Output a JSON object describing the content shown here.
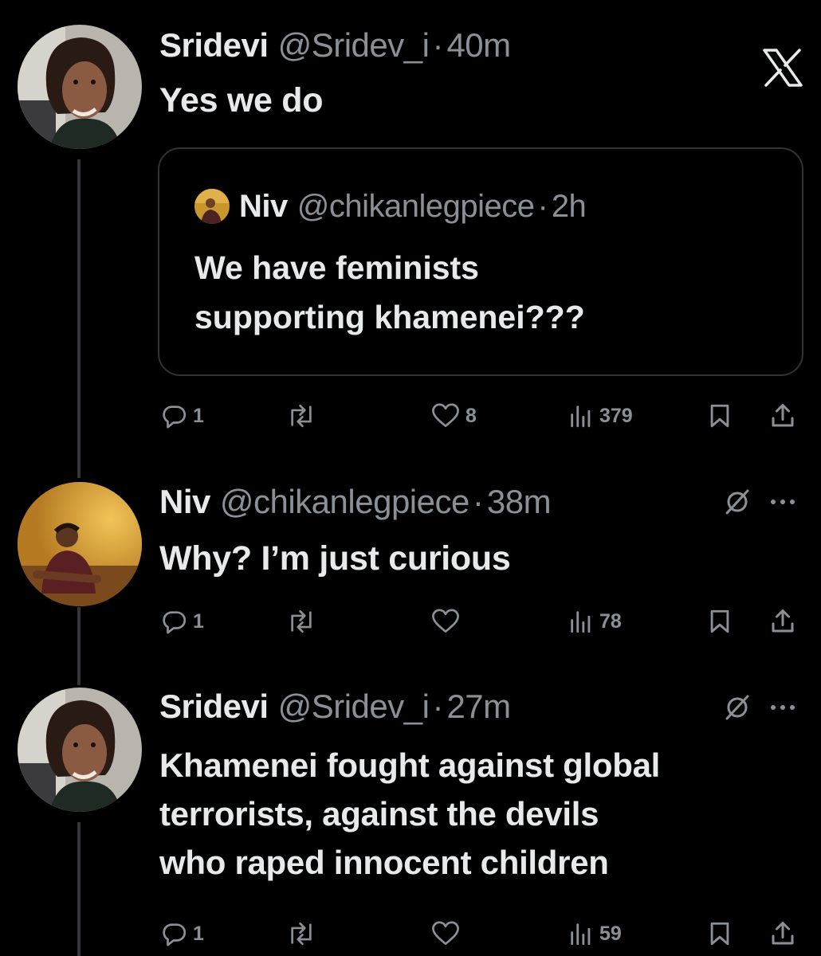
{
  "logo": "x-logo",
  "tweets": [
    {
      "name": "Sridevi",
      "handle": "@Sridev_i",
      "separator": "·",
      "time": "40m",
      "text": "Yes we do",
      "quote": {
        "name": "Niv",
        "handle": "@chikanlegpiece",
        "separator": "·",
        "time": "2h",
        "text_lines": [
          "We have feminists",
          "supporting khamenei???"
        ]
      },
      "actions": {
        "replies": "1",
        "reposts": "",
        "likes": "8",
        "views": "379"
      }
    },
    {
      "name": "Niv",
      "handle": "@chikanlegpiece",
      "separator": "·",
      "time": "38m",
      "text": "Why? I’m just curious",
      "actions": {
        "replies": "1",
        "reposts": "",
        "likes": "",
        "views": "78"
      }
    },
    {
      "name": "Sridevi",
      "handle": "@Sridev_i",
      "separator": "·",
      "time": "27m",
      "text_lines": [
        "Khamenei fought against global",
        "terrorists, against the devils",
        "who raped innocent children"
      ],
      "actions": {
        "replies": "1",
        "reposts": "",
        "likes": "",
        "views": "59"
      }
    }
  ],
  "icons": {
    "reply": "reply-icon",
    "repost": "repost-icon",
    "like": "heart-icon",
    "views": "views-icon",
    "bookmark": "bookmark-icon",
    "share": "share-icon",
    "grok": "grok-icon",
    "more": "more-icon"
  },
  "colors": {
    "background": "#000000",
    "text": "#e7e9ea",
    "secondary": "#8b9096",
    "border": "#2f3336"
  }
}
